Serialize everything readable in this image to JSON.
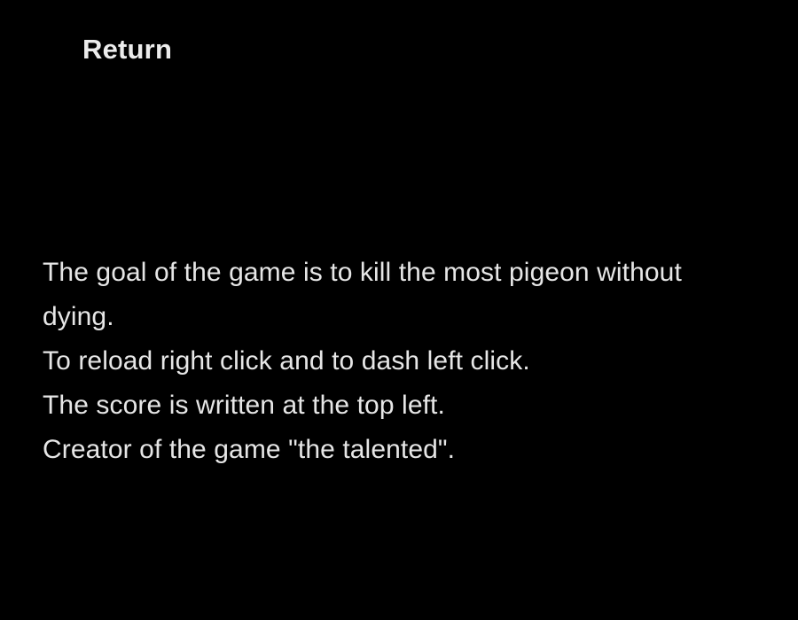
{
  "screen": {
    "return_label": "Return",
    "instructions": [
      "The goal of the game is to kill the most pigeon without",
      "dying.",
      "To reload right click and to dash left click.",
      "The score is written at the top left.",
      "Creator of the game \"the talented\"."
    ]
  },
  "colors": {
    "background": "#000000",
    "text": "#e6e6e6"
  }
}
